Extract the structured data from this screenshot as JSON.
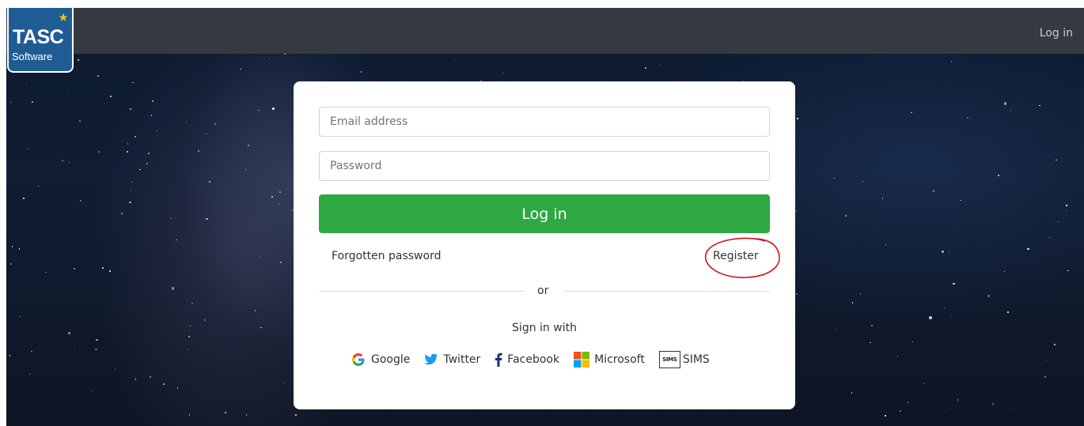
{
  "header": {
    "logo_title": "TASC",
    "logo_subtitle": "Software",
    "login_link": "Log in"
  },
  "form": {
    "email_placeholder": "Email address",
    "password_placeholder": "Password",
    "login_button": "Log in",
    "forgotten_password": "Forgotten password",
    "register": "Register",
    "or_label": "or",
    "sign_in_with": "Sign in with"
  },
  "providers": [
    {
      "label": "Google",
      "icon": "google-icon"
    },
    {
      "label": "Twitter",
      "icon": "twitter-icon"
    },
    {
      "label": "Facebook",
      "icon": "facebook-icon"
    },
    {
      "label": "Microsoft",
      "icon": "microsoft-icon"
    },
    {
      "label": "SIMS",
      "icon": "sims-icon",
      "badge_text": "SIMS"
    }
  ],
  "colors": {
    "topbar": "#353a41",
    "primary_button": "#2ea843",
    "logo_blue": "#1f5c94",
    "annotation_red": "#d0101a"
  }
}
